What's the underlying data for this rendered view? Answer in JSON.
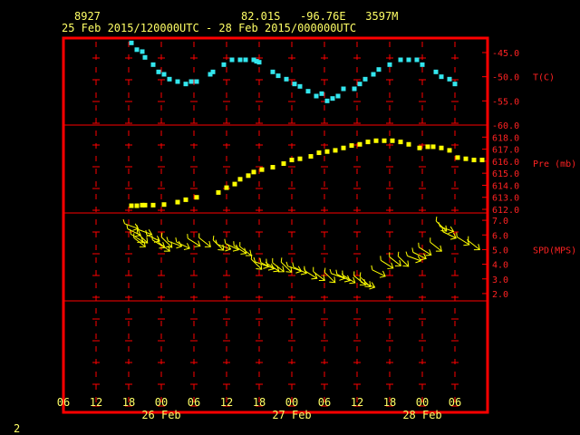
{
  "header": {
    "station": "8927",
    "location": "82.01S   -96.76E   3597M",
    "time_range": "25 Feb 2015/120000UTC - 28 Feb 2015/000000UTC"
  },
  "footer": {
    "page": "2"
  },
  "colors": {
    "frame": "#ff0000",
    "text": "#ffff66",
    "temp": "#33e6ee",
    "pres": "#ffff00",
    "wind": "#ffff00",
    "axis_text": "#ff2222"
  },
  "chart_data": [
    {
      "type": "scatter",
      "title": "",
      "ylabel": "T(C)",
      "ylim": [
        -60.0,
        -42.0
      ],
      "yticks": [
        "-45.0",
        "-50.0",
        "-55.0",
        "-60.0"
      ],
      "ytick_values": [
        -45,
        -50,
        -55,
        -60
      ],
      "x": [
        12.5,
        13.5,
        14.5,
        15.0,
        16.5,
        17.5,
        18.5,
        19.5,
        21.0,
        22.5,
        23.5,
        24.5,
        27.0,
        27.5,
        29.5,
        31.0,
        32.5,
        33.5,
        35.0,
        35.5,
        36.0,
        38.5,
        39.5,
        41.0,
        42.5,
        43.5,
        45.0,
        46.5,
        47.5,
        48.5,
        49.5,
        50.5,
        51.5,
        53.5,
        54.5,
        55.5,
        57.0,
        58.0,
        60.0,
        62.0,
        63.5,
        65.0,
        66.0,
        68.5,
        69.5,
        71.0,
        72.0
      ],
      "y": [
        -43.0,
        -44.4,
        -44.8,
        -46.0,
        -47.5,
        -49.0,
        -49.5,
        -50.5,
        -51.0,
        -51.5,
        -51.0,
        -51.0,
        -49.5,
        -49.0,
        -47.5,
        -46.5,
        -46.5,
        -46.5,
        -46.5,
        -46.8,
        -47.0,
        -49.0,
        -49.8,
        -50.5,
        -51.5,
        -52.0,
        -53.0,
        -54.0,
        -53.5,
        -55.0,
        -54.5,
        -54.0,
        -52.5,
        -52.5,
        -51.5,
        -50.5,
        -49.5,
        -48.5,
        -47.5,
        -46.5,
        -46.5,
        -46.5,
        -47.5,
        -49.0,
        -50.0,
        -50.5,
        -51.5
      ]
    },
    {
      "type": "scatter",
      "title": "",
      "ylabel": "Pre (mb)",
      "ylim": [
        611.7,
        619.0
      ],
      "yticks": [
        "618.0",
        "617.0",
        "616.0",
        "615.0",
        "614.0",
        "613.0",
        "612.0"
      ],
      "ytick_values": [
        618,
        617,
        616,
        615,
        614,
        613,
        612
      ],
      "x": [
        12.5,
        13.5,
        14.5,
        15.0,
        16.5,
        18.5,
        21.0,
        22.5,
        24.5,
        28.5,
        30.0,
        31.5,
        32.5,
        34.0,
        35.0,
        36.5,
        38.5,
        40.5,
        42.0,
        43.5,
        45.5,
        47.0,
        48.5,
        50.0,
        51.5,
        53.0,
        54.5,
        56.0,
        57.5,
        59.0,
        60.5,
        62.0,
        63.5,
        65.5,
        67.0,
        68.0,
        69.5,
        71.0,
        72.5,
        74.0,
        75.5,
        77.0
      ],
      "y": [
        612.3,
        612.3,
        612.35,
        612.35,
        612.35,
        612.4,
        612.6,
        612.8,
        613.0,
        613.4,
        613.8,
        614.1,
        614.5,
        614.8,
        615.1,
        615.3,
        615.5,
        615.8,
        616.1,
        616.2,
        616.4,
        616.7,
        616.8,
        616.9,
        617.1,
        617.3,
        617.4,
        617.6,
        617.7,
        617.7,
        617.7,
        617.6,
        617.4,
        617.1,
        617.2,
        617.2,
        617.1,
        616.9,
        616.3,
        616.2,
        616.1,
        616.1
      ]
    },
    {
      "type": "scatter",
      "title": "",
      "ylabel": "SPD(MPS)",
      "ylim": [
        1.5,
        7.5
      ],
      "yticks": [
        "7.0",
        "6.0",
        "5.0",
        "4.0",
        "3.0",
        "2.0"
      ],
      "ytick_values": [
        7,
        6,
        5,
        4,
        3,
        2
      ],
      "x": [
        12.5,
        13.0,
        13.5,
        14.0,
        14.5,
        15.0,
        16.5,
        17.5,
        18.5,
        19.0,
        20.5,
        22.0,
        24.0,
        26.0,
        28.5,
        29.5,
        31.0,
        32.5,
        33.5,
        35.5,
        36.5,
        37.5,
        38.5,
        39.5,
        41.0,
        42.5,
        43.5,
        45.5,
        47.0,
        49.0,
        50.5,
        51.5,
        52.5,
        54.5,
        55.5,
        56.0,
        58.0,
        59.5,
        61.0,
        62.5,
        64.5,
        65.5,
        66.5,
        68.5,
        69.5,
        70.5,
        71.0,
        73.5,
        75.5
      ],
      "y": [
        6.6,
        6.2,
        5.8,
        5.5,
        5.8,
        6.2,
        5.8,
        5.4,
        5.2,
        5.5,
        5.4,
        5.3,
        5.5,
        5.5,
        5.3,
        5.2,
        5.2,
        5.0,
        4.9,
        4.0,
        4.0,
        3.9,
        3.8,
        3.8,
        3.8,
        3.7,
        3.6,
        3.3,
        3.2,
        3.1,
        3.2,
        3.1,
        3.0,
        2.9,
        2.8,
        2.6,
        3.4,
        4.0,
        4.2,
        4.2,
        4.4,
        4.6,
        4.9,
        5.2,
        6.6,
        6.4,
        6.0,
        5.6,
        5.3
      ]
    }
  ],
  "xaxis": {
    "xlim": [
      0,
      78
    ],
    "ticks": [
      "06",
      "12",
      "18",
      "00",
      "06",
      "12",
      "18",
      "00",
      "06",
      "12",
      "18",
      "00",
      "06"
    ],
    "tick_values": [
      0,
      6,
      12,
      18,
      24,
      30,
      36,
      42,
      48,
      54,
      60,
      66,
      72,
      78
    ],
    "day_labels": [
      "26 Feb",
      "27 Feb",
      "28 Feb"
    ],
    "day_positions": [
      18,
      42,
      66
    ]
  }
}
